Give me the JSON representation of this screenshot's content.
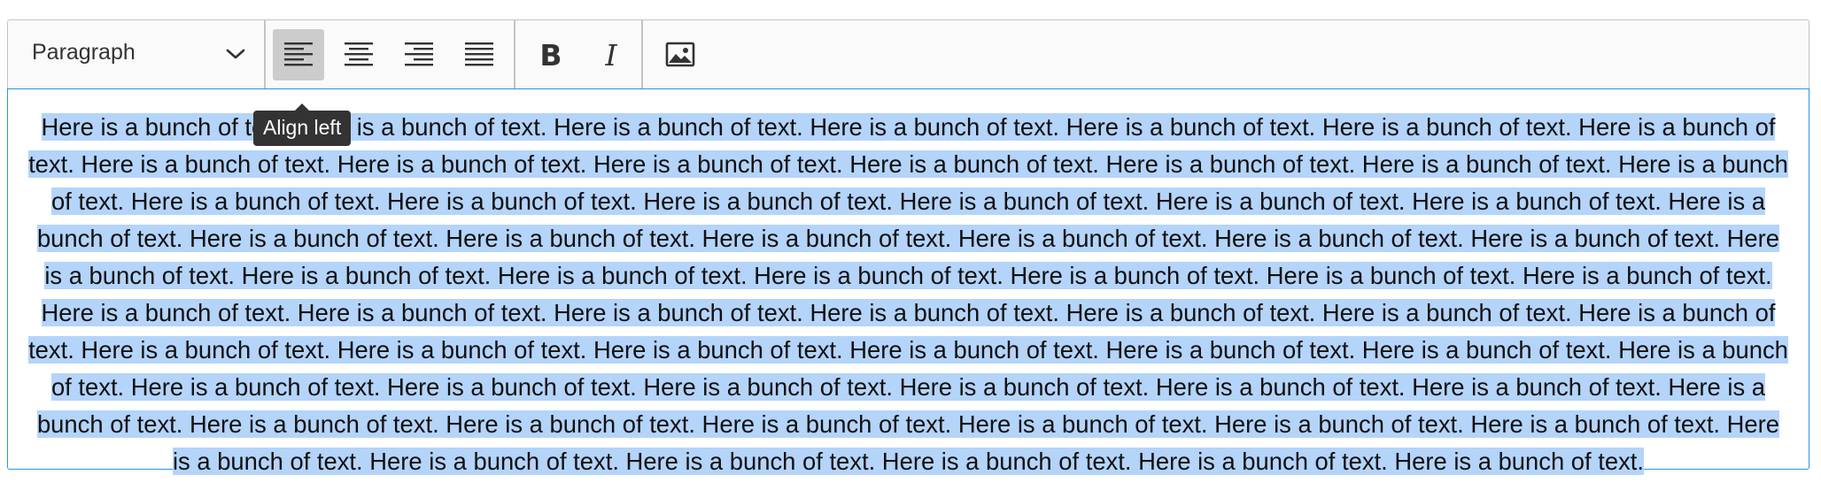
{
  "toolbar": {
    "heading_value": "Paragraph",
    "tooltip": "Align left",
    "buttons": [
      {
        "name": "align-left",
        "icon": "align-left-icon",
        "active": true
      },
      {
        "name": "align-center",
        "icon": "align-center-icon",
        "active": false
      },
      {
        "name": "align-right",
        "icon": "align-right-icon",
        "active": false
      },
      {
        "name": "align-justify",
        "icon": "align-justify-icon",
        "active": false
      },
      {
        "name": "bold",
        "icon": "bold-icon",
        "active": false
      },
      {
        "name": "italic",
        "icon": "italic-icon",
        "active": false
      },
      {
        "name": "insert-image",
        "icon": "image-icon",
        "active": false
      }
    ]
  },
  "content": {
    "paragraph": "Here is a bunch of text. Here is a bunch of text. Here is a bunch of text. Here is a bunch of text. Here is a bunch of text. Here is a bunch of text. Here is a bunch of text. Here is a bunch of text. Here is a bunch of text. Here is a bunch of text. Here is a bunch of text. Here is a bunch of text. Here is a bunch of text. Here is a bunch of text. Here is a bunch of text. Here is a bunch of text. Here is a bunch of text. Here is a bunch of text. Here is a bunch of text. Here is a bunch of text. Here is a bunch of text. Here is a bunch of text. Here is a bunch of text. Here is a bunch of text. Here is a bunch of text. Here is a bunch of text. Here is a bunch of text. Here is a bunch of text. Here is a bunch of text. Here is a bunch of text. Here is a bunch of text. Here is a bunch of text. Here is a bunch of text. Here is a bunch of text. Here is a bunch of text. Here is a bunch of text. Here is a bunch of text. Here is a bunch of text. Here is a bunch of text. Here is a bunch of text. Here is a bunch of text. Here is a bunch of text. Here is a bunch of text. Here is a bunch of text. Here is a bunch of text. Here is a bunch of text. Here is a bunch of text. Here is a bunch of text. Here is a bunch of text. Here is a bunch of text. Here is a bunch of text. Here is a bunch of text. Here is a bunch of text. Here is a bunch of text. Here is a bunch of text. Here is a bunch of text. Here is a bunch of text. Here is a bunch of text. Here is a bunch of text. Here is a bunch of text. Here is a bunch of text. Here is a bunch of text. Here is a bunch of text. Here is a bunch of text. Here is a bunch of text. Here is a bunch of text. Here is a bunch of text.",
    "selected": true
  },
  "colors": {
    "selection": "#b4d4fa",
    "focus_border": "#2196f3",
    "toolbar_border": "#c4c4c4",
    "toolbar_bg": "#fafafa",
    "active_button": "#cccccc",
    "tooltip_bg": "#333333"
  }
}
